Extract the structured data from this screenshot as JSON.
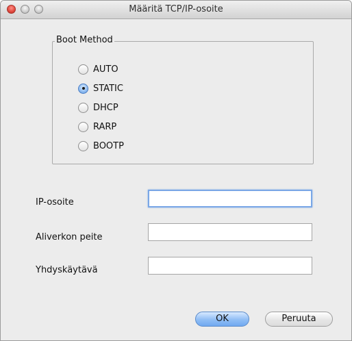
{
  "window": {
    "title": "Määritä TCP/IP-osoite"
  },
  "boot_method": {
    "label": "Boot Method",
    "options": [
      {
        "label": "AUTO",
        "checked": false
      },
      {
        "label": "STATIC",
        "checked": true
      },
      {
        "label": "DHCP",
        "checked": false
      },
      {
        "label": "RARP",
        "checked": false
      },
      {
        "label": "BOOTP",
        "checked": false
      }
    ],
    "selected": "STATIC"
  },
  "fields": {
    "ip_label": "IP-osoite",
    "ip_value": "",
    "subnet_label": "Aliverkon peite",
    "subnet_value": "",
    "gateway_label": "Yhdyskäytävä",
    "gateway_value": ""
  },
  "buttons": {
    "ok_label": "OK",
    "cancel_label": "Peruuta"
  }
}
